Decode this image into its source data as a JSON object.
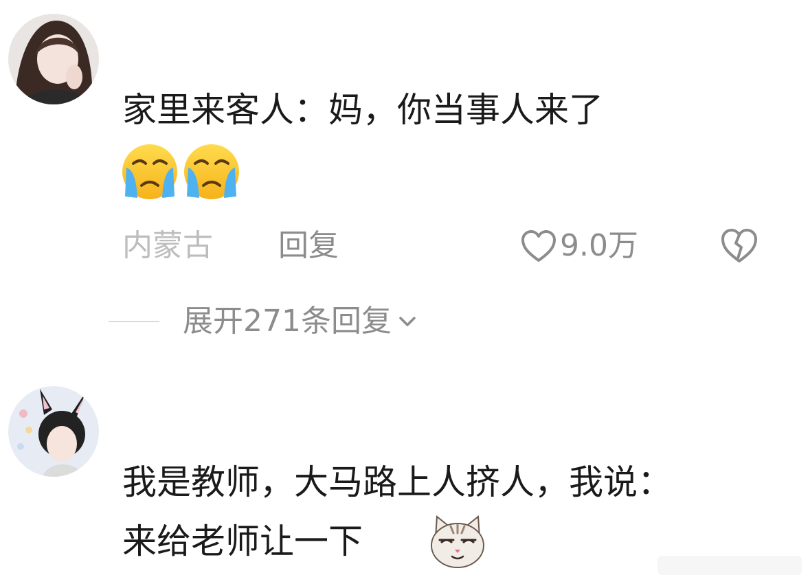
{
  "comments": [
    {
      "avatar": "user-avatar-photo",
      "text": "家里来客人：妈，你当事人来了",
      "emojis": [
        "loudly-crying-face-emoji",
        "loudly-crying-face-emoji"
      ],
      "location": "内蒙古",
      "reply_label": "回复",
      "like_icon": "heart-outline-icon",
      "like_count": "9.0万",
      "dislike_icon": "broken-heart-outline-icon",
      "expand_label": "展开271条回复",
      "expand_icon": "chevron-down-icon"
    },
    {
      "avatar": "user-avatar-photo",
      "line1": "我是教师，大马路上人挤人，我说：",
      "line2": "来给老师让一下",
      "emoji": "smug-cat-face-emoji"
    }
  ],
  "colors": {
    "text": "#1a1a1a",
    "meta": "#8c8c8c",
    "location": "#bdbdbd",
    "divider": "#d9d9d9"
  }
}
